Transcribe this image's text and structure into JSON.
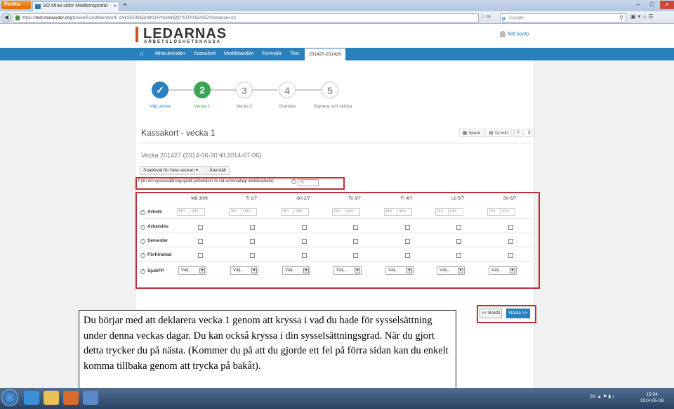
{
  "browser": {
    "app_button": "Firefox",
    "tab_title": "SO Mina sidor Medlemsportal",
    "url_prefix": "https://",
    "url_host": "test.minasidor.org",
    "url_rest": "/prweb/FundMember/F-cNk3SRRKBnHt1HYm3hlbQ[[*/!STANDARD?instance=z3",
    "search_placeholder": "Google"
  },
  "site": {
    "logo": "LEDARNAS",
    "logo_sub": "ARBETSLÖSHETSKASSA",
    "account": "Mitt konto",
    "nav": [
      "Mina ärenden",
      "Kassakort",
      "Meddelanden",
      "Formulär",
      "Test"
    ],
    "nav_active": "201427-201428"
  },
  "steps": [
    {
      "num": "✓",
      "label": "Välj vecka"
    },
    {
      "num": "2",
      "label": "Vecka 1"
    },
    {
      "num": "3",
      "label": "Vecka 2"
    },
    {
      "num": "4",
      "label": "Granska"
    },
    {
      "num": "5",
      "label": "Signera och skicka"
    }
  ],
  "form": {
    "title": "Kassakort - vecka 1",
    "tools": {
      "save": "Spara",
      "delete": "Ta bort",
      "help": "?",
      "close": "X"
    },
    "week": "Vecka 201427 (2014-06-30 till 2014-07-06)",
    "quick_select": "Snabbval för hela veckan",
    "reset": "Återställ",
    "employment_label": "Fyll i din sysselsättningsgrad (arbetstid i % vid schemalagt deltidsarbete)",
    "employment_placeholder": "%",
    "days": [
      "Må 30/6",
      "Ti 1/7",
      "On 2/7",
      "To 3/7",
      "Fr 4/7",
      "Lö 5/7",
      "Sö 6/7"
    ],
    "rows": [
      "Arbete",
      "Arbetslös",
      "Semester",
      "Förhindrad",
      "Sjuk/FP"
    ],
    "time_h": "tim",
    "time_m": "min",
    "select_value": "Välj...",
    "back": "<< Bakåt",
    "next": "Nästa >>"
  },
  "note": "Du börjar med att deklarera vecka 1 genom att kryssa i vad du hade för sysselsättning under denna veckas dagar. Du kan också kryssa i din sysselsättningsgrad. När du gjort detta trycker du på nästa. (Kommer du på att du gjorde ett fel på förra sidan kan du enkelt komma tillbaka genom att trycka på bakåt).",
  "taskbar": {
    "lang": "SV",
    "time": "15:54",
    "date": "2014-05-08"
  },
  "colors": {
    "brand_blue": "#2b80be",
    "step_green": "#3aa655",
    "highlight_red": "#c0303a",
    "logo_orange": "#c8542a"
  }
}
